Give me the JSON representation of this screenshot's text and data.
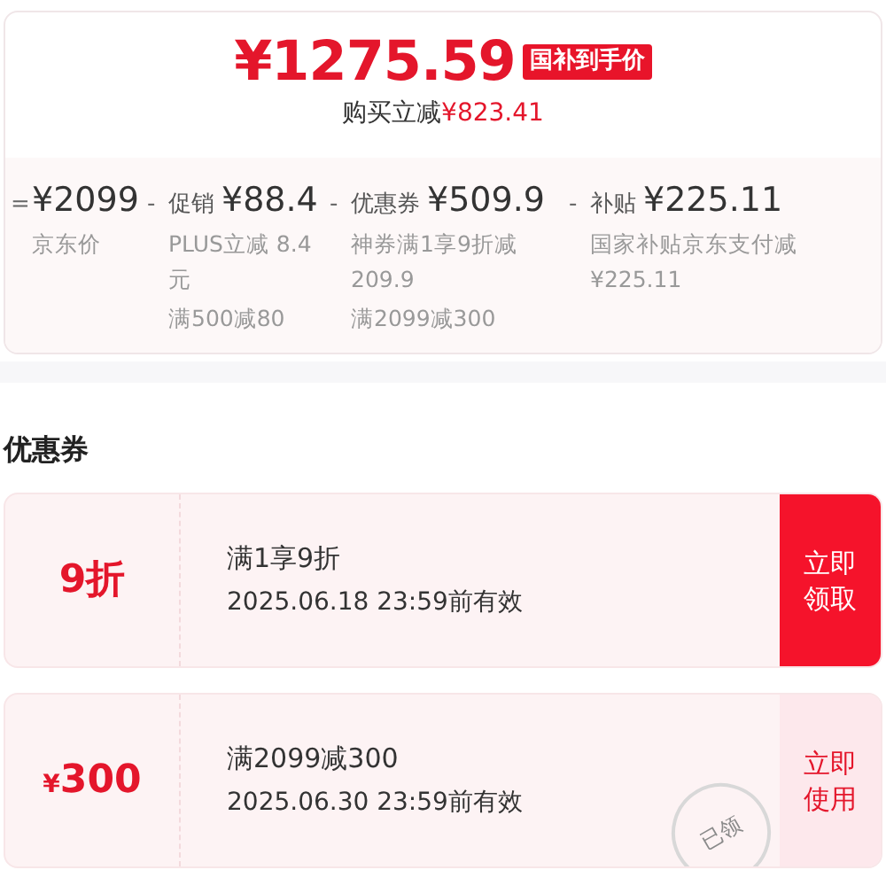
{
  "price_card": {
    "price": "¥1275.59",
    "badge": "国补到手价",
    "saving_label": "购买立减",
    "saving_amount": "¥823.41",
    "breakdown": [
      {
        "sign": "=",
        "amount": "¥2099",
        "notes": [
          "京东价"
        ]
      },
      {
        "sign": "-",
        "label": "促销",
        "amount": "¥88.4",
        "notes": [
          "PLUS立减 8.4元",
          "满500减80"
        ]
      },
      {
        "sign": "-",
        "label": "优惠券",
        "amount": "¥509.9",
        "notes": [
          "神券满1享9折减209.9",
          "满2099减300"
        ]
      },
      {
        "sign": "-",
        "label": "补贴",
        "amount": "¥225.11",
        "notes": [
          "国家补贴京东支付减¥225.11"
        ]
      }
    ]
  },
  "coupons_section": {
    "title": "优惠券",
    "coupons": [
      {
        "value": "9折",
        "condition": "满1享9折",
        "validity": "2025.06.18 23:59前有效",
        "action": "立即领取",
        "claimed": false
      },
      {
        "value_prefix": "¥",
        "value": "300",
        "condition": "满2099减300",
        "validity": "2025.06.30 23:59前有效",
        "action": "立即使用",
        "claimed": true,
        "stamp": "已领"
      }
    ]
  }
}
